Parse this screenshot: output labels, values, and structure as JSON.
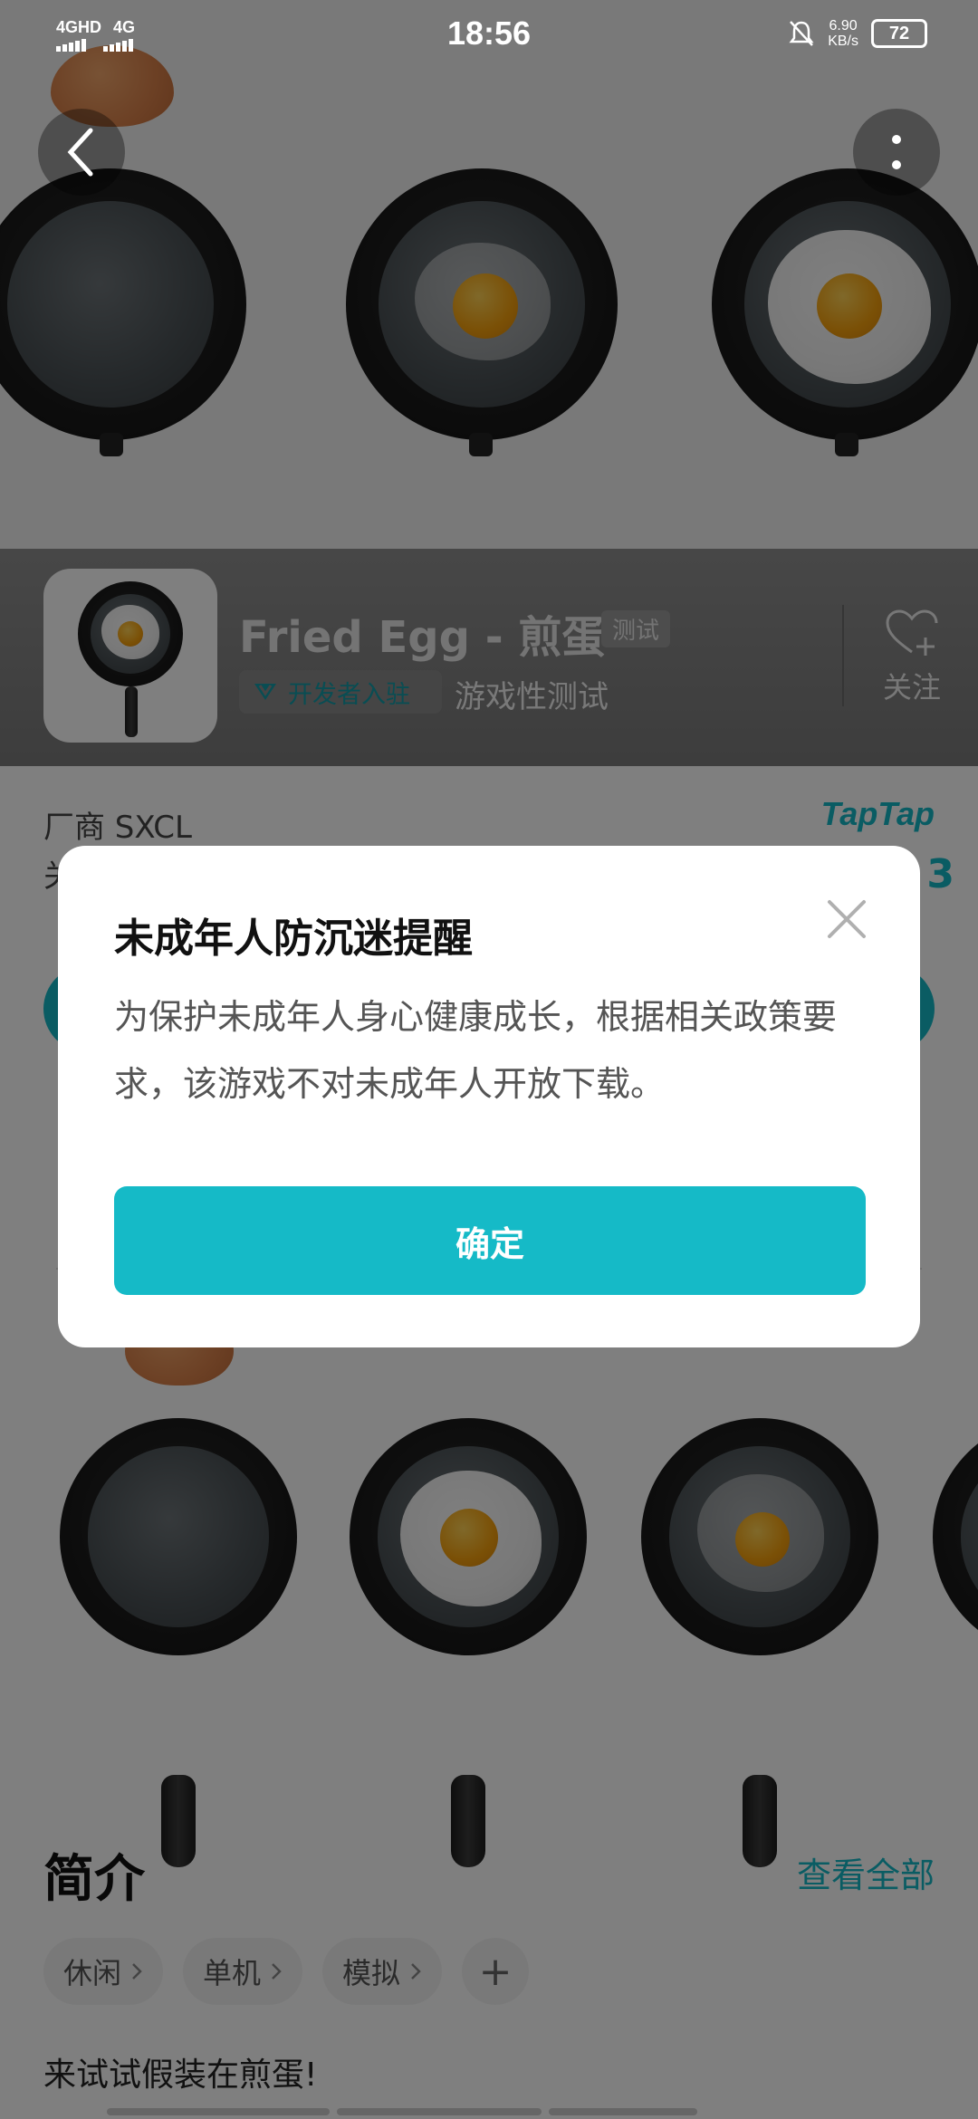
{
  "status_bar": {
    "time": "18:56",
    "network_1": "4GHD",
    "network_2": "4G",
    "speed_value": "6.90",
    "speed_unit": "KB/s",
    "battery": "72",
    "icons": [
      "signal-icon",
      "mute-bell-icon",
      "battery-icon"
    ]
  },
  "app": {
    "title": "Fried Egg - 煎蛋",
    "test_tag": "测试",
    "dev_badge": "开发者入驻",
    "status": "游戏性测试",
    "follow_label": "关注",
    "vendor": "厂商 SXCL",
    "brand": "TapTap",
    "partial_left_char": "关",
    "partial_right_char": "3"
  },
  "intro": {
    "title": "简介",
    "view_all": "查看全部",
    "tags": [
      {
        "label": "休闲"
      },
      {
        "label": "单机"
      },
      {
        "label": "模拟"
      }
    ],
    "add_tag": "+",
    "description": "来试试假装在煎蛋!"
  },
  "dialog": {
    "title": "未成年人防沉迷提醒",
    "body": "为保护未成年人身心健康成长，根据相关政策要求，该游戏不对未成年人开放下载。",
    "confirm": "确定"
  },
  "colors": {
    "accent": "#15bac7",
    "overlay": "rgba(0,0,0,0.5)"
  }
}
